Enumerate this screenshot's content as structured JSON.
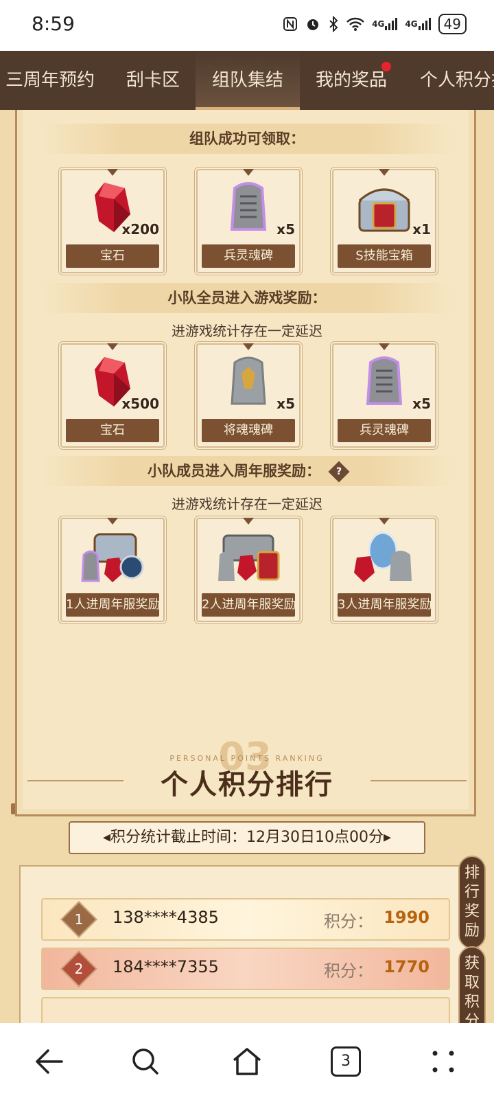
{
  "status": {
    "time": "8:59",
    "signal1": "4G",
    "signal2": "4G",
    "battery": "49"
  },
  "tabs": [
    "三周年预约",
    "刮卡区",
    "组队集结",
    "我的奖品",
    "个人积分排"
  ],
  "sections": {
    "team_success": {
      "title": "组队成功可领取：",
      "items": [
        {
          "name": "宝石",
          "qty": "x200",
          "icon": "red-gem"
        },
        {
          "name": "兵灵魂碑",
          "qty": "x5",
          "icon": "purple-tablet"
        },
        {
          "name": "S技能宝箱",
          "qty": "x1",
          "icon": "chest"
        }
      ]
    },
    "all_enter": {
      "title": "小队全员进入游戏奖励：",
      "note": "进游戏统计存在一定延迟",
      "items": [
        {
          "name": "宝石",
          "qty": "x500",
          "icon": "red-gem"
        },
        {
          "name": "将魂魂碑",
          "qty": "x5",
          "icon": "gold-tablet"
        },
        {
          "name": "兵灵魂碑",
          "qty": "x5",
          "icon": "purple-tablet"
        }
      ]
    },
    "anniversary": {
      "title": "小队成员进入周年服奖励：",
      "help": "?",
      "note": "进游戏统计存在一定延迟",
      "items": [
        {
          "name": "1人进周年服奖励",
          "icon": "bundle"
        },
        {
          "name": "2人进周年服奖励",
          "icon": "bundle"
        },
        {
          "name": "3人进周年服奖励",
          "icon": "bundle"
        }
      ]
    }
  },
  "ranking": {
    "ghost": "03",
    "subtitle": "PERSONAL POINTS RANKING",
    "title": "个人积分排行",
    "deadline": "◂积分统计截止时间：12月30日10点00分▸",
    "side_tabs": [
      "排行奖励",
      "获取积分"
    ],
    "points_label": "积分：",
    "rows": [
      {
        "rank": "1",
        "user": "138****4385",
        "points": "1990"
      },
      {
        "rank": "2",
        "user": "184****7355",
        "points": "1770"
      }
    ]
  },
  "nav": {
    "tab_count": "3"
  }
}
